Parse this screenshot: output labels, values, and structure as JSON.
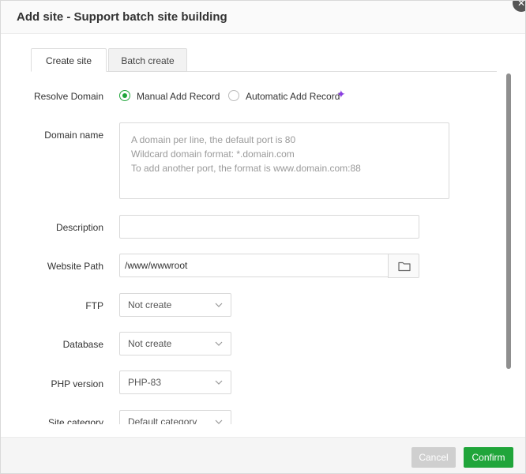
{
  "dialog": {
    "title": "Add site - Support batch site building"
  },
  "tabs": [
    {
      "label": "Create site",
      "active": true
    },
    {
      "label": "Batch create",
      "active": false
    }
  ],
  "form": {
    "resolve_domain": {
      "label": "Resolve Domain",
      "options": [
        {
          "label": "Manual Add Record",
          "checked": true
        },
        {
          "label": "Automatic Add Record",
          "checked": false
        }
      ]
    },
    "domain_name": {
      "label": "Domain name",
      "placeholder_lines": [
        "A domain per line, the default port is 80",
        "Wildcard domain format: *.domain.com",
        "To add another port, the format is www.domain.com:88"
      ]
    },
    "description": {
      "label": "Description",
      "value": ""
    },
    "website_path": {
      "label": "Website Path",
      "value": "/www/wwwroot"
    },
    "ftp": {
      "label": "FTP",
      "value": "Not create"
    },
    "database": {
      "label": "Database",
      "value": "Not create"
    },
    "php_version": {
      "label": "PHP version",
      "value": "PHP-83"
    },
    "site_category": {
      "label": "Site category",
      "value": "Default category"
    }
  },
  "footer": {
    "cancel_label": "Cancel",
    "confirm_label": "Confirm"
  },
  "colors": {
    "accent": "#20a53a",
    "sparkle": "#8a3ee0",
    "cancel_bg": "#cfcfcf"
  },
  "icons": {
    "close": "close-icon",
    "sparkle": "sparkle-icon",
    "folder": "folder-icon",
    "chevron": "chevron-down-icon"
  }
}
